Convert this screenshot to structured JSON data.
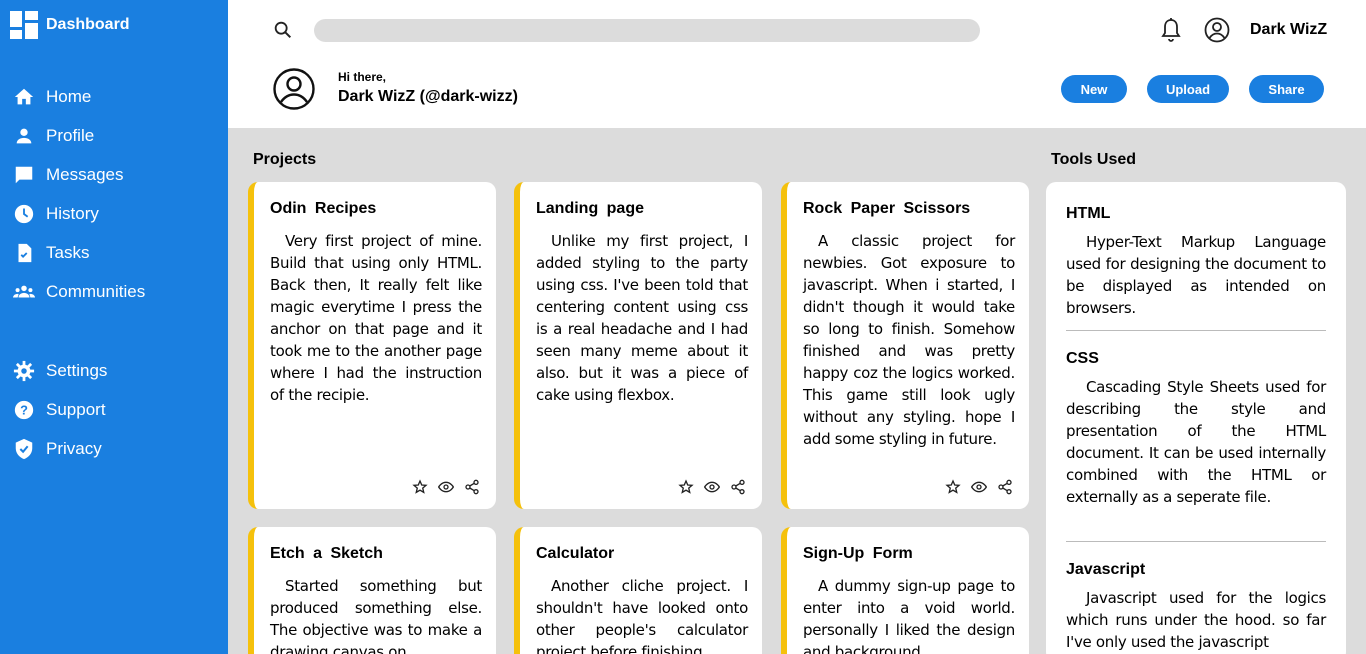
{
  "sidebar": {
    "brand": "Dashboard",
    "items": [
      {
        "label": "Home",
        "icon": "home-icon"
      },
      {
        "label": "Profile",
        "icon": "person-icon"
      },
      {
        "label": "Messages",
        "icon": "message-icon"
      },
      {
        "label": "History",
        "icon": "clock-icon"
      },
      {
        "label": "Tasks",
        "icon": "task-icon"
      },
      {
        "label": "Communities",
        "icon": "group-icon"
      }
    ],
    "secondary": [
      {
        "label": "Settings",
        "icon": "gear-icon"
      },
      {
        "label": "Support",
        "icon": "help-icon"
      },
      {
        "label": "Privacy",
        "icon": "shield-icon"
      }
    ]
  },
  "header": {
    "search_placeholder": "",
    "username": "Dark WizZ",
    "greeting": "Hi there,",
    "display_name": "Dark WizZ (@dark-wizz)",
    "buttons": {
      "new": "New",
      "upload": "Upload",
      "share": "Share"
    }
  },
  "projects": {
    "title": "Projects",
    "cards": [
      {
        "title": "Odin Recipes",
        "desc": "Very first project of mine. Build that using only HTML. Back then, It really felt like magic everytime I press the anchor on that page and it took me to the another page where I had the instruction of the recipie."
      },
      {
        "title": "Landing page",
        "desc": "Unlike my first project, I added styling to the party using css. I've been told that centering content using css is a real headache and I had seen many meme about it also. but it was a piece of cake using flexbox."
      },
      {
        "title": "Rock Paper Scissors",
        "desc": "A classic project for newbies. Got exposure to javascript. When i started, I didn't though it would take so long to finish. Somehow finished and was pretty happy coz the logics worked. This game still look ugly without any styling. hope I add some styling in future."
      },
      {
        "title": "Etch a Sketch",
        "desc": "Started something but produced something else. The objective was to make a drawing canvas on"
      },
      {
        "title": "Calculator",
        "desc": "Another cliche project. I shouldn't have looked onto other people's calculator project before finishing"
      },
      {
        "title": "Sign-Up Form",
        "desc": "A dummy sign-up page to enter into a void world. personally I liked the design and background"
      }
    ]
  },
  "tools": {
    "title": "Tools Used",
    "items": [
      {
        "name": "HTML",
        "desc": "Hyper-Text Markup Language used for designing the document to be displayed as intended on browsers."
      },
      {
        "name": "CSS",
        "desc": "Cascading Style Sheets used for describing the style and presentation of the HTML document. It can be used internally combined with the HTML or externally as a seperate file."
      },
      {
        "name": "Javascript",
        "desc": "Javascript used for the logics which runs under the hood. so far I've only used the javascript"
      }
    ]
  },
  "colors": {
    "accent": "#1a7fe0",
    "card_border": "#f5c10c",
    "background": "#dcdcdc"
  }
}
